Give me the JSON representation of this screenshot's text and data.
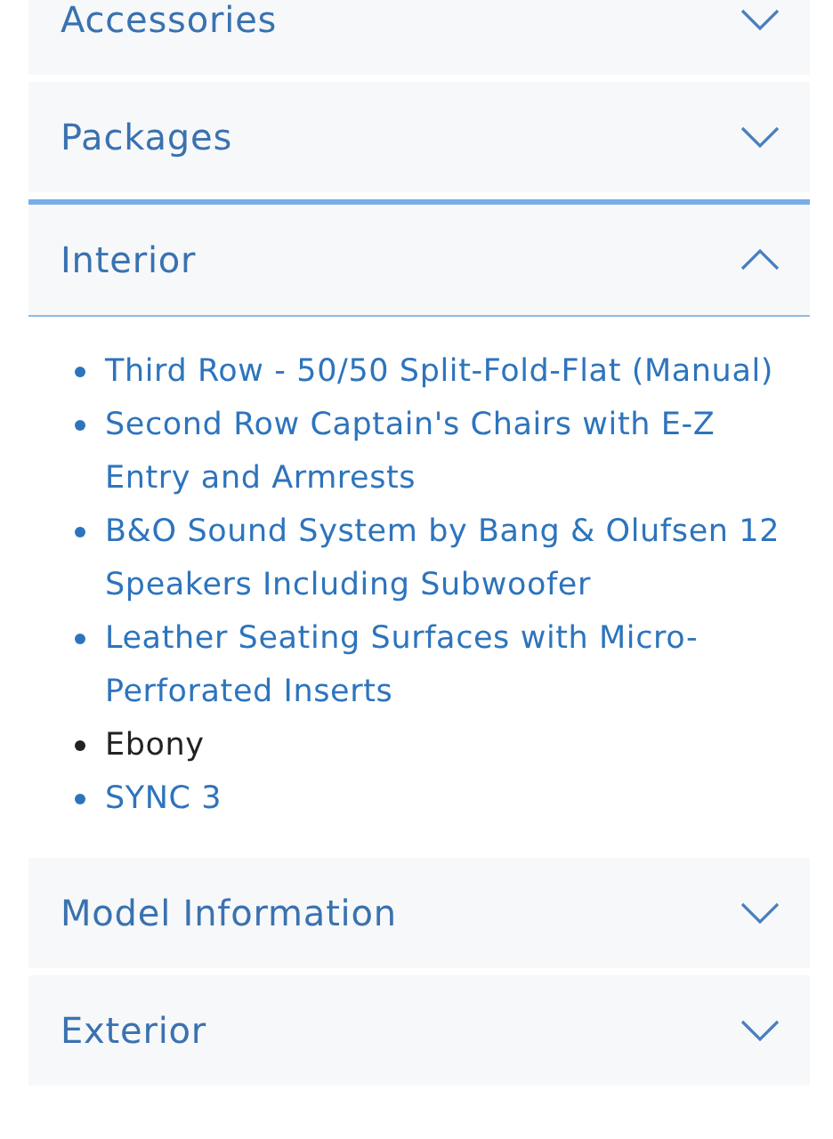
{
  "sections": [
    {
      "title": "Accessories",
      "expanded": false
    },
    {
      "title": "Packages",
      "expanded": false
    },
    {
      "title": "Interior",
      "expanded": true,
      "items": [
        {
          "text": "Third Row - 50/50 Split-Fold-Flat (Manual)",
          "kind": "link"
        },
        {
          "text": "Second Row Captain's Chairs with E-Z Entry and Armrests",
          "kind": "link"
        },
        {
          "text": "B&O Sound System by Bang & Olufsen 12 Speakers Including Subwoofer",
          "kind": "link"
        },
        {
          "text": "Leather Seating Surfaces with Micro-Perforated Inserts",
          "kind": "link"
        },
        {
          "text": "Ebony",
          "kind": "text"
        },
        {
          "text": "SYNC 3",
          "kind": "link"
        }
      ]
    },
    {
      "title": "Model Information",
      "expanded": false
    },
    {
      "title": "Exterior",
      "expanded": false
    }
  ]
}
